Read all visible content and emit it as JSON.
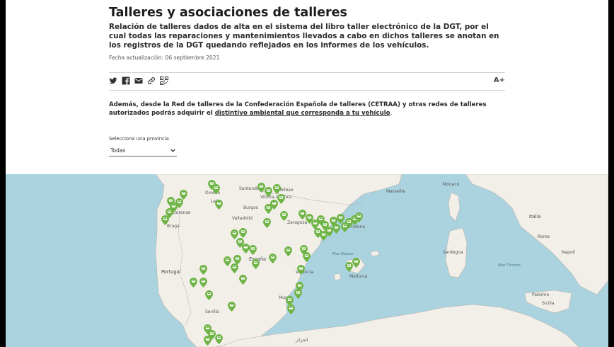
{
  "page": {
    "title": "Talleres y asociaciones de talleres",
    "lead": "Relación de talleres dados de alta en el sistema del libro taller electrónico de la DGT, por el cual todas las reparaciones y mantenimientos llevados a cabo en dichos talleres se anotan en los registros de la DGT quedando reflejados en los informes de los vehículos.",
    "updated": "Fecha actualización: 06 septiembre 2021"
  },
  "share": {
    "icons": [
      "twitter-icon",
      "facebook-icon",
      "email-icon",
      "link-icon",
      "qr-code-icon"
    ],
    "font_size_label": "A+"
  },
  "note": {
    "text_before": "Además, desde la Red de talleres de la Confederación Española de talleres (CETRAA) y otras redes de talleres autorizados podrás adquirir el ",
    "link_text": "distintivo ambiental  que corresponda a tu vehículo",
    "text_after": "."
  },
  "province_select": {
    "label": "Selecciona una provincia",
    "value": "Todas"
  },
  "map": {
    "labels": {
      "santander": "Santander",
      "bilbao": "Bilbao",
      "oviedo": "Oviedo",
      "leon": "León",
      "burgos": "Burgos",
      "ourense": "Ourense",
      "braga": "Braga",
      "valladolid": "Valladolid",
      "vitoria": "Vitoria-Gasteiz",
      "zaragoza": "Zaragoza",
      "barcelona": "Barcelona",
      "portugal": "Portugal",
      "espana": "España",
      "valencia": "Valencia",
      "sevilla": "Sevilla",
      "murcia": "Murcia",
      "mallorca": "Mallorca",
      "marseille": "Marseille",
      "monaco": "Monaco",
      "italia": "Italia",
      "roma": "Roma",
      "sardegna": "Sardegna",
      "napoli": "Napoli",
      "palermo": "Palermo",
      "sicilia": "Sicilia",
      "mar_balear": "Mar Balear",
      "mar_tirreno": "Mar Tirreno",
      "algerie": "الجزائر"
    }
  },
  "colors": {
    "marker": "#6fb446",
    "sea": "#aad3df",
    "land": "#f2efe9"
  }
}
